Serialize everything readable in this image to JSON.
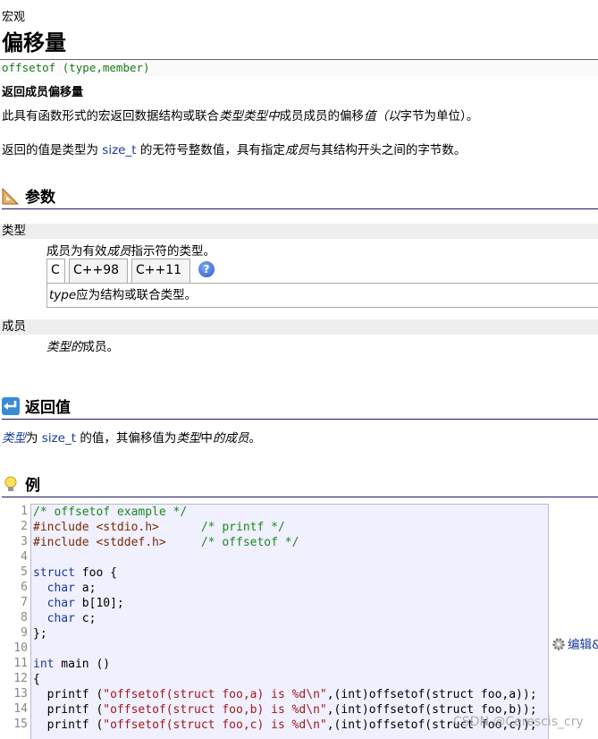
{
  "breadcrumb": "宏观",
  "title": "偏移量",
  "signature": "offsetof (type,member)",
  "subheading": "返回成员偏移量",
  "intro": {
    "p1_a": "此具有函数形式的宏返回数据结构或联合",
    "p1_em1": "类型类型中",
    "p1_b": "成员成员的偏移",
    "p1_em2": "值（以",
    "p1_c": "字节为单位）。",
    "p2_a": "返回的值是类型为 ",
    "p2_code": "size_t",
    "p2_b": " 的无符号整数值，具有指定",
    "p2_em": "成员",
    "p2_c": "与其结构开头之间的字节数。"
  },
  "params_section": {
    "heading": "参数",
    "type_param": {
      "name": "类型",
      "desc_a": "成员为有效",
      "desc_em": "成员",
      "desc_b": "指示符的类型。",
      "tabs": [
        "C",
        "C++98",
        "C++11"
      ],
      "help_label": "?",
      "tab_content_em": "type",
      "tab_content": "应为结构或联合类型。"
    },
    "member_param": {
      "name": "成员",
      "desc_em": "类型的",
      "desc": "成员。"
    }
  },
  "return_section": {
    "heading": "返回值",
    "text_em1": "类型",
    "text_a": "为 ",
    "text_code": "size_t",
    "text_b": " 的值，其偏移值为",
    "text_em2": "类型",
    "text_c": "中",
    "text_em3": "的成员",
    "text_d": "。"
  },
  "example_section": {
    "heading": "例",
    "line_numbers": [
      "1",
      "2",
      "3",
      "4",
      "5",
      "6",
      "7",
      "8",
      "9",
      "10",
      "11",
      "12",
      "13",
      "14",
      "15"
    ],
    "edit_label": "编辑&",
    "code": {
      "l1": "/* offsetof example */",
      "l2_pp": "#include <stdio.h>",
      "l2_sp": "      ",
      "l2_cmt": "/* printf */",
      "l3_pp": "#include <stddef.h>",
      "l3_sp": "     ",
      "l3_cmt": "/* offsetof */",
      "l5_kw": "struct",
      "l5_rest": " foo {",
      "l6_kw": "char",
      "l6_rest": " a;",
      "l7_kw": "char",
      "l7_rest": " b[10];",
      "l8_kw": "char",
      "l8_rest": " c;",
      "l9": "};",
      "l11_kw": "int",
      "l11_rest": " main ()",
      "l12": "{",
      "l13_a": "printf (",
      "l13_str": "\"offsetof(struct foo,a) is %d\\n\"",
      "l13_b": ",(int)offsetof(struct foo,a));",
      "l14_a": "printf (",
      "l14_str": "\"offsetof(struct foo,b) is %d\\n\"",
      "l14_b": ",(int)offsetof(struct foo,b));",
      "l15_a": "printf (",
      "l15_str": "\"offsetof(struct foo,c) is %d\\n\"",
      "l15_b": ",(int)offsetof(struct foo,c));"
    }
  },
  "watermark": "CSDN @Cerescis_cry"
}
